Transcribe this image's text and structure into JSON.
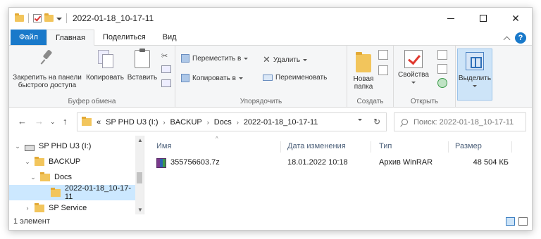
{
  "window": {
    "title": "2022-01-18_10-17-11"
  },
  "tabs": [
    {
      "label": "Файл"
    },
    {
      "label": "Главная"
    },
    {
      "label": "Поделиться"
    },
    {
      "label": "Вид"
    }
  ],
  "ribbon": {
    "clipboard": {
      "group_label": "Буфер обмена",
      "pin_line1": "Закрепить на панели",
      "pin_line2": "быстрого доступа",
      "copy": "Копировать",
      "paste": "Вставить"
    },
    "organize": {
      "group_label": "Упорядочить",
      "move_to": "Переместить в",
      "copy_to": "Копировать в",
      "delete": "Удалить",
      "rename": "Переименовать"
    },
    "create": {
      "group_label": "Создать",
      "new_folder_line1": "Новая",
      "new_folder_line2": "папка"
    },
    "open": {
      "group_label": "Открыть",
      "properties": "Свойства"
    },
    "select": {
      "label": "Выделить"
    }
  },
  "address": {
    "crumbs": [
      "SP PHD U3 (I:)",
      "BACKUP",
      "Docs",
      "2022-01-18_10-17-11"
    ],
    "overflow": "«"
  },
  "search": {
    "placeholder": "Поиск: 2022-01-18_10-17-11"
  },
  "nav_tree": [
    {
      "label": "SP PHD U3 (I:)",
      "chevron": "⌄",
      "kind": "drive"
    },
    {
      "label": "BACKUP",
      "chevron": "⌄",
      "kind": "folder"
    },
    {
      "label": "Docs",
      "chevron": "⌄",
      "kind": "folder"
    },
    {
      "label": "2022-01-18_10-17-11",
      "chevron": "",
      "kind": "folder"
    },
    {
      "label": "SP Service",
      "chevron": "›",
      "kind": "folder"
    }
  ],
  "columns": {
    "name": "Имя",
    "modified": "Дата изменения",
    "type": "Тип",
    "size": "Размер"
  },
  "files": [
    {
      "name": "355756603.7z",
      "modified": "18.01.2022 10:18",
      "type": "Архив WinRAR",
      "size": "48 504 КБ",
      "icon": "winrar-archive-icon"
    }
  ],
  "status": {
    "item_count": "1 элемент"
  },
  "colors": {
    "accent": "#1979ca",
    "selection": "#cce8ff",
    "folder": "#f2c55c"
  }
}
